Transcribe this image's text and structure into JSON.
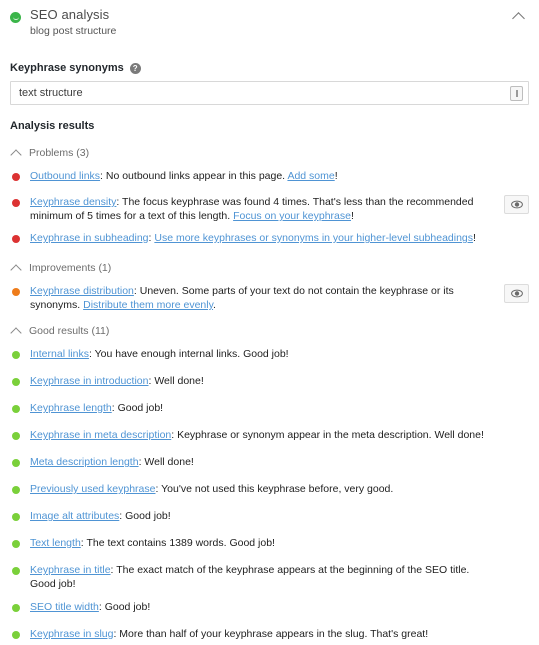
{
  "panel": {
    "status_icon": "smiley-green-icon",
    "status_color": "#3bb54a",
    "title": "SEO analysis",
    "subtitle": "blog post structure",
    "collapse_icon": "chevron-up-icon"
  },
  "synonyms_field": {
    "label": "Keyphrase synonyms",
    "help_icon": "help-question-icon",
    "help_glyph": "?",
    "value": "text structure",
    "placeholder": "",
    "affix_icon": "text-cursor-icon"
  },
  "analysis": {
    "heading": "Analysis results",
    "groups": [
      {
        "key": "problems",
        "toggle_icon": "chevron-up-icon",
        "label": "Problems (3)",
        "count": 3,
        "dot_class": "dot-red",
        "dot_color": "#dc3232",
        "items": [
          {
            "name": "Outbound links",
            "html": "<a class=\"lead\">Outbound links</a>: No outbound links appear in this page. <a>Add some</a>!",
            "has_eye": false
          },
          {
            "name": "Keyphrase density",
            "html": "<a class=\"lead\">Keyphrase density</a>: The focus keyphrase was found 4 times. That's less than the recommended minimum of 5 times for a text of this length. <a>Focus on your keyphrase</a>!",
            "has_eye": true,
            "eye_icon": "eye-icon"
          },
          {
            "name": "Keyphrase in subheading",
            "html": "<a class=\"lead\">Keyphrase in subheading</a>: <a>Use more keyphrases or synonyms in your higher-level subheadings</a>!",
            "has_eye": false
          }
        ]
      },
      {
        "key": "improvements",
        "toggle_icon": "chevron-up-icon",
        "label": "Improvements (1)",
        "count": 1,
        "dot_class": "dot-orange",
        "dot_color": "#ee7c1b",
        "items": [
          {
            "name": "Keyphrase distribution",
            "html": "<a class=\"lead\">Keyphrase distribution</a>: Uneven. Some parts of your text do not contain the keyphrase or its synonyms. <a>Distribute them more evenly</a>.",
            "has_eye": true,
            "eye_icon": "eye-icon"
          }
        ]
      },
      {
        "key": "good",
        "toggle_icon": "chevron-up-icon",
        "label": "Good results (11)",
        "count": 11,
        "dot_class": "dot-green",
        "dot_color": "#7ad03a",
        "items": [
          {
            "name": "Internal links",
            "html": "<a class=\"lead\">Internal links</a>: You have enough internal links. Good job!",
            "has_eye": false
          },
          {
            "name": "Keyphrase in introduction",
            "html": "<a class=\"lead\">Keyphrase in introduction</a>: Well done!",
            "has_eye": false
          },
          {
            "name": "Keyphrase length",
            "html": "<a class=\"lead\">Keyphrase length</a>: Good job!",
            "has_eye": false
          },
          {
            "name": "Keyphrase in meta description",
            "html": "<a class=\"lead\">Keyphrase in meta description</a>: Keyphrase or synonym appear in the meta description. Well done!",
            "has_eye": false
          },
          {
            "name": "Meta description length",
            "html": "<a class=\"lead\">Meta description length</a>: Well done!",
            "has_eye": false
          },
          {
            "name": "Previously used keyphrase",
            "html": "<a class=\"lead\">Previously used keyphrase</a>: You've not used this keyphrase before, very good.",
            "has_eye": false
          },
          {
            "name": "Image alt attributes",
            "html": "<a class=\"lead\">Image alt attributes</a>: Good job!",
            "has_eye": false
          },
          {
            "name": "Text length",
            "html": "<a class=\"lead\">Text length</a>: The text contains 1389 words. Good job!",
            "has_eye": false
          },
          {
            "name": "Keyphrase in title",
            "html": "<a class=\"lead\">Keyphrase in title</a>: The exact match of the keyphrase appears at the beginning of the SEO title. Good job!",
            "has_eye": false
          },
          {
            "name": "SEO title width",
            "html": "<a class=\"lead\">SEO title width</a>: Good job!",
            "has_eye": false
          },
          {
            "name": "Keyphrase in slug",
            "html": "<a class=\"lead\">Keyphrase in slug</a>: More than half of your keyphrase appears in the slug. That's great!",
            "has_eye": false
          }
        ]
      }
    ]
  }
}
